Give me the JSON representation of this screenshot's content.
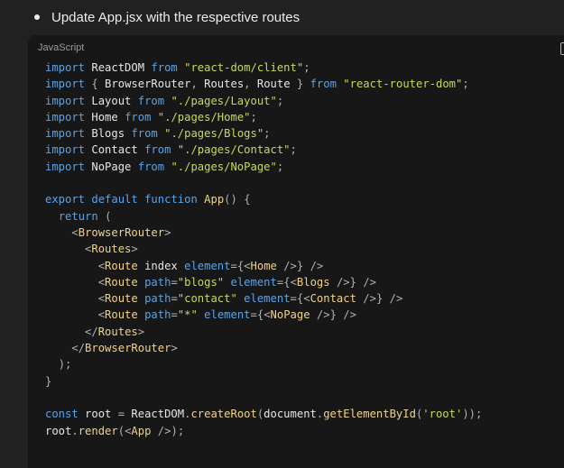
{
  "bullet": {
    "text": "Update App.jsx with the respective routes"
  },
  "code_block": {
    "language_label": "JavaScript",
    "copy_icon": "copy-icon",
    "lines": [
      "import ReactDOM from \"react-dom/client\";",
      "import { BrowserRouter, Routes, Route } from \"react-router-dom\";",
      "import Layout from \"./pages/Layout\";",
      "import Home from \"./pages/Home\";",
      "import Blogs from \"./pages/Blogs\";",
      "import Contact from \"./pages/Contact\";",
      "import NoPage from \"./pages/NoPage\";",
      "",
      "export default function App() {",
      "  return (",
      "    <BrowserRouter>",
      "      <Routes>",
      "        <Route index element={<Home />} />",
      "        <Route path=\"blogs\" element={<Blogs />} />",
      "        <Route path=\"contact\" element={<Contact />} />",
      "        <Route path=\"*\" element={<NoPage />} />",
      "      </Routes>",
      "    </BrowserRouter>",
      "  );",
      "}",
      "",
      "const root = ReactDOM.createRoot(document.getElementById('root'));",
      "root.render(<App />);"
    ]
  }
}
